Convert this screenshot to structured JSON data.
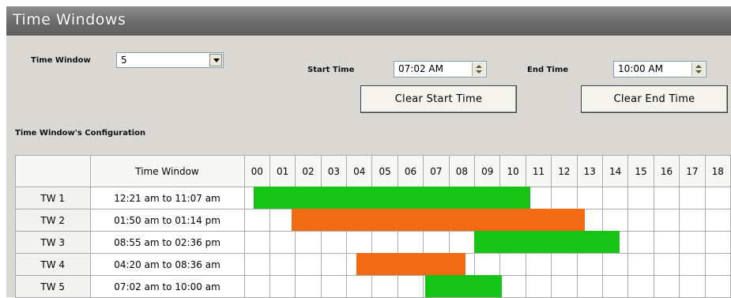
{
  "header": {
    "title": "Time Windows"
  },
  "controls": {
    "time_window_label": "Time Window",
    "time_window_value": "5",
    "start_time_label": "Start Time",
    "start_time_value": "07:02 AM",
    "end_time_label": "End Time",
    "end_time_value": "10:00 AM",
    "clear_start_label": "Clear Start Time",
    "clear_end_label": "Clear End Time"
  },
  "config": {
    "section_label": "Time Window's Configuration",
    "col_time_window": "Time Window",
    "hours": [
      "00",
      "01",
      "02",
      "03",
      "04",
      "05",
      "06",
      "07",
      "08",
      "09",
      "10",
      "11",
      "12",
      "13",
      "14",
      "15",
      "16",
      "17",
      "18"
    ],
    "rows": [
      {
        "tw": "TW 1",
        "range": "12:21 am to 11:07 am",
        "start_hour": 0.35,
        "end_hour": 11.12,
        "color": "#16c416"
      },
      {
        "tw": "TW 2",
        "range": "01:50 am to 01:14 pm",
        "start_hour": 1.83,
        "end_hour": 13.23,
        "color": "#f26a14"
      },
      {
        "tw": "TW 3",
        "range": "08:55 am to 02:36 pm",
        "start_hour": 8.92,
        "end_hour": 14.6,
        "color": "#16c416"
      },
      {
        "tw": "TW 4",
        "range": "04:20 am to 08:36 am",
        "start_hour": 4.33,
        "end_hour": 8.6,
        "color": "#f26a14"
      },
      {
        "tw": "TW 5",
        "range": "07:02 am to 10:00 am",
        "start_hour": 7.03,
        "end_hour": 10.0,
        "color": "#16c416"
      }
    ]
  }
}
